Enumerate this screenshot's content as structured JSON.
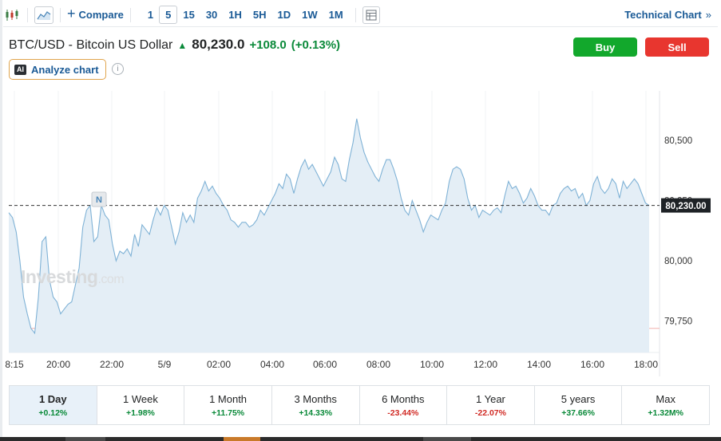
{
  "toolbar": {
    "compare_label": "Compare",
    "intervals": [
      "1",
      "5",
      "15",
      "30",
      "1H",
      "5H",
      "1D",
      "1W",
      "1M"
    ],
    "active_interval": "5",
    "technical_chart_label": "Technical Chart",
    "technical_chart_arrow": "»"
  },
  "instrument": {
    "name": "BTC/USD - Bitcoin US Dollar",
    "price": "80,230.0",
    "change": "+108.0",
    "change_pct": "(+0.13%)",
    "direction_icon": "up-arrow-icon"
  },
  "actions": {
    "buy_label": "Buy",
    "sell_label": "Sell"
  },
  "analyze": {
    "badge": "AI",
    "label": "Analyze chart",
    "info_glyph": "i"
  },
  "watermark": {
    "brand": "Investing",
    "suffix": ".com"
  },
  "chart_data": {
    "type": "area",
    "x_ticks": [
      "8:15",
      "20:00",
      "22:00",
      "5/9",
      "02:00",
      "04:00",
      "06:00",
      "08:00",
      "10:00",
      "12:00",
      "14:00",
      "16:00",
      "18:00"
    ],
    "y_ticks": [
      "80,500",
      "80,250",
      "80,000",
      "79,750"
    ],
    "ylim": [
      79,
      620,
      80,
      705
    ],
    "current_price_label": "80,230.00",
    "marker_label": "N",
    "values": [
      80200,
      80180,
      80120,
      80000,
      79850,
      79780,
      79720,
      79700,
      79850,
      80080,
      80100,
      79920,
      79850,
      79830,
      79780,
      79800,
      79820,
      79830,
      79900,
      79970,
      80140,
      80210,
      80230,
      80080,
      80100,
      80230,
      80190,
      80170,
      80070,
      80000,
      80040,
      80030,
      80050,
      80020,
      80110,
      80060,
      80150,
      80130,
      80110,
      80170,
      80220,
      80190,
      80230,
      80210,
      80140,
      80070,
      80120,
      80200,
      80160,
      80190,
      80160,
      80260,
      80290,
      80330,
      80290,
      80310,
      80280,
      80260,
      80230,
      80210,
      80170,
      80160,
      80140,
      80160,
      80160,
      80140,
      80150,
      80170,
      80210,
      80190,
      80220,
      80250,
      80280,
      80320,
      80300,
      80360,
      80340,
      80280,
      80340,
      80390,
      80420,
      80380,
      80400,
      80370,
      80340,
      80310,
      80340,
      80370,
      80430,
      80400,
      80340,
      80330,
      80420,
      80490,
      80590,
      80510,
      80450,
      80410,
      80380,
      80350,
      80330,
      80380,
      80420,
      80420,
      80380,
      80330,
      80260,
      80210,
      80190,
      80250,
      80210,
      80170,
      80120,
      80160,
      80190,
      80180,
      80170,
      80210,
      80240,
      80330,
      80380,
      80390,
      80380,
      80340,
      80260,
      80210,
      80230,
      80180,
      80210,
      80200,
      80190,
      80210,
      80220,
      80200,
      80270,
      80330,
      80300,
      80310,
      80280,
      80240,
      80260,
      80300,
      80270,
      80230,
      80210,
      80210,
      80190,
      80230,
      80240,
      80280,
      80300,
      80310,
      80290,
      80300,
      80260,
      80280,
      80230,
      80250,
      80320,
      80350,
      80300,
      80280,
      80300,
      80340,
      80320,
      80260,
      80330,
      80300,
      80320,
      80340,
      80320,
      80280,
      80240,
      80230
    ],
    "last_value": 80230,
    "colors": {
      "line": "#7fb2d6",
      "fill": "#e4eef6",
      "price_line": "#333333",
      "base_line": "#f2b0ad"
    }
  },
  "periods": [
    {
      "label": "1 Day",
      "value": "+0.12%",
      "dir": "pos",
      "active": true
    },
    {
      "label": "1 Week",
      "value": "+1.98%",
      "dir": "pos"
    },
    {
      "label": "1 Month",
      "value": "+11.75%",
      "dir": "pos"
    },
    {
      "label": "3 Months",
      "value": "+14.33%",
      "dir": "pos"
    },
    {
      "label": "6 Months",
      "value": "-23.44%",
      "dir": "neg"
    },
    {
      "label": "1 Year",
      "value": "-22.07%",
      "dir": "neg"
    },
    {
      "label": "5 years",
      "value": "+37.66%",
      "dir": "pos"
    },
    {
      "label": "Max",
      "value": "+1.32M%",
      "dir": "pos"
    }
  ]
}
